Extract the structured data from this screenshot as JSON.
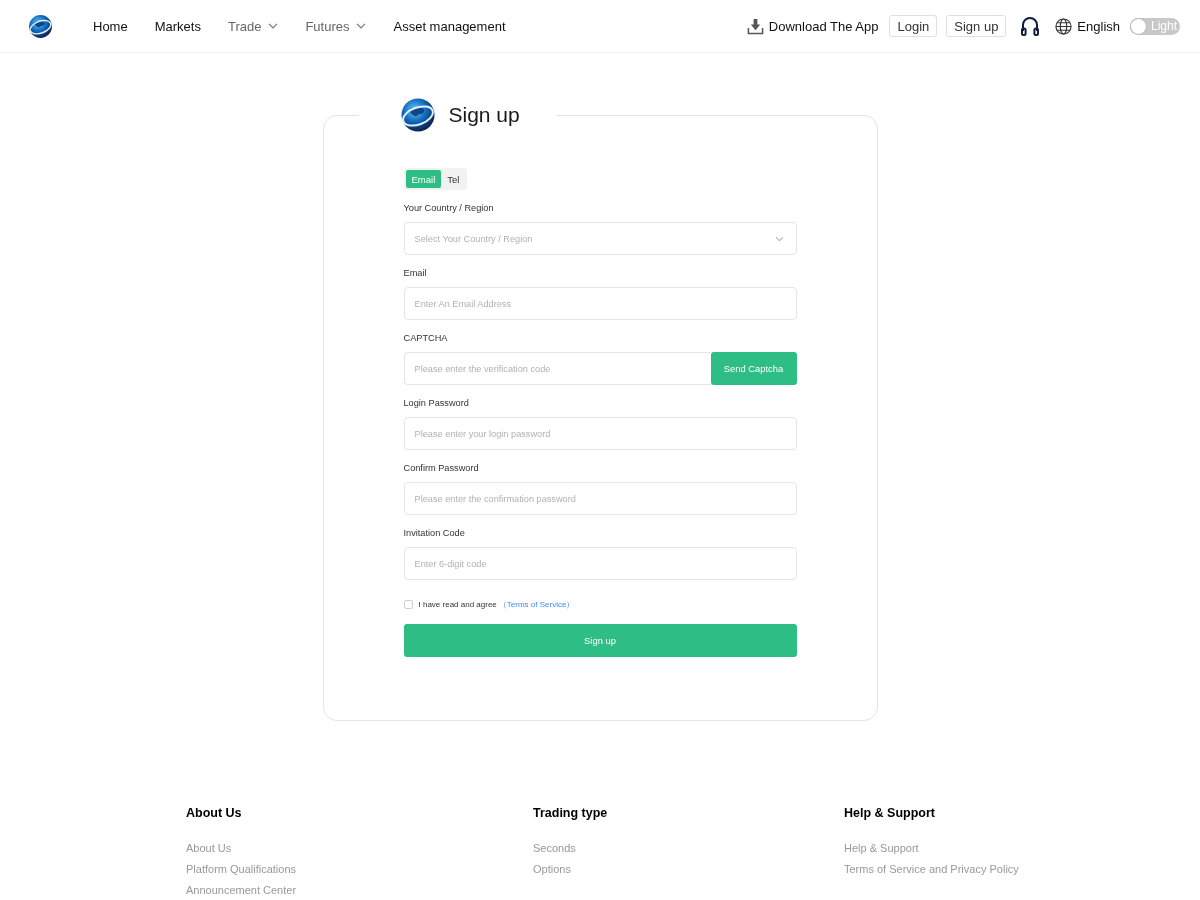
{
  "header": {
    "nav": [
      {
        "label": "Home",
        "kind": "link"
      },
      {
        "label": "Markets",
        "kind": "link"
      },
      {
        "label": "Trade",
        "kind": "dropdown"
      },
      {
        "label": "Futures",
        "kind": "dropdown"
      },
      {
        "label": "Asset management",
        "kind": "link"
      }
    ],
    "download": "Download The App",
    "login": "Login",
    "signup": "Sign up",
    "language": "English",
    "theme_toggle": {
      "label": "Light",
      "on": false
    }
  },
  "form": {
    "title": "Sign up",
    "tabs": [
      {
        "label": "Email",
        "selected": true
      },
      {
        "label": "Tel",
        "selected": false
      }
    ],
    "fields": [
      {
        "kind": "select",
        "label": "Your Country / Region",
        "placeholder": "Select Your Country / Region"
      },
      {
        "kind": "text",
        "label": "Email",
        "placeholder": "Enter An Email Address"
      },
      {
        "kind": "captcha",
        "label": "CAPTCHA",
        "placeholder": "Please enter the verification code",
        "button": "Send Captcha"
      },
      {
        "kind": "text",
        "label": "Login Password",
        "placeholder": "Please enter your login password"
      },
      {
        "kind": "text",
        "label": "Confirm Password",
        "placeholder": "Please enter the confirmation password"
      },
      {
        "kind": "text",
        "label": "Invitation Code",
        "placeholder": "Enter 6-digit code"
      }
    ],
    "agreement": {
      "checked": false,
      "text": "I have read and agree",
      "link": "（Terms of Service）"
    },
    "submit": "Sign up"
  },
  "footer": {
    "columns": [
      {
        "title": "About Us",
        "links": [
          "About Us",
          "Platform Qualifications",
          "Announcement Center"
        ]
      },
      {
        "title": "Trading type",
        "links": [
          "Seconds",
          "Options"
        ]
      },
      {
        "title": "Help & Support",
        "links": [
          "Help & Support",
          "Terms of Service and Privacy Policy"
        ]
      }
    ]
  }
}
